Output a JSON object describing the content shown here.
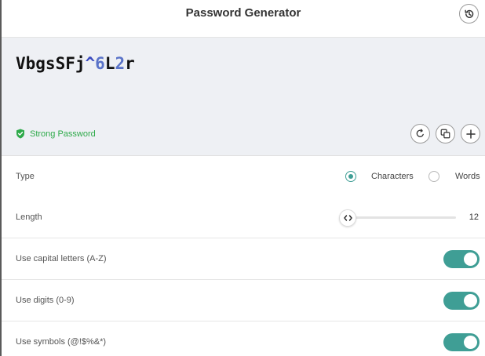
{
  "header": {
    "title": "Password Generator",
    "history_icon": "history-icon"
  },
  "password": {
    "segments": [
      {
        "text": "VbgsSFj",
        "kind": "letter"
      },
      {
        "text": "^",
        "kind": "symbol"
      },
      {
        "text": "6",
        "kind": "digit"
      },
      {
        "text": "L",
        "kind": "letter"
      },
      {
        "text": "2",
        "kind": "digit"
      },
      {
        "text": "r",
        "kind": "letter"
      }
    ],
    "strength_label": "Strong Password",
    "strength_icon": "shield-check-icon",
    "actions": [
      "regenerate-icon",
      "copy-icon",
      "plus-icon"
    ]
  },
  "settings": {
    "type": {
      "label": "Type",
      "options": [
        "Characters",
        "Words"
      ],
      "selected": "Characters"
    },
    "length": {
      "label": "Length",
      "value": "12",
      "slider_fraction": 0.07
    },
    "capitals": {
      "label": "Use capital letters (A-Z)",
      "enabled": true
    },
    "digits": {
      "label": "Use digits (0-9)",
      "enabled": true
    },
    "symbols": {
      "label": "Use symbols (@!$%&*)",
      "enabled": true
    }
  },
  "colors": {
    "accent": "#3f9e95",
    "strength": "#2eaa4a",
    "digit": "#5a73c8",
    "symbol": "#3b4bbf"
  }
}
